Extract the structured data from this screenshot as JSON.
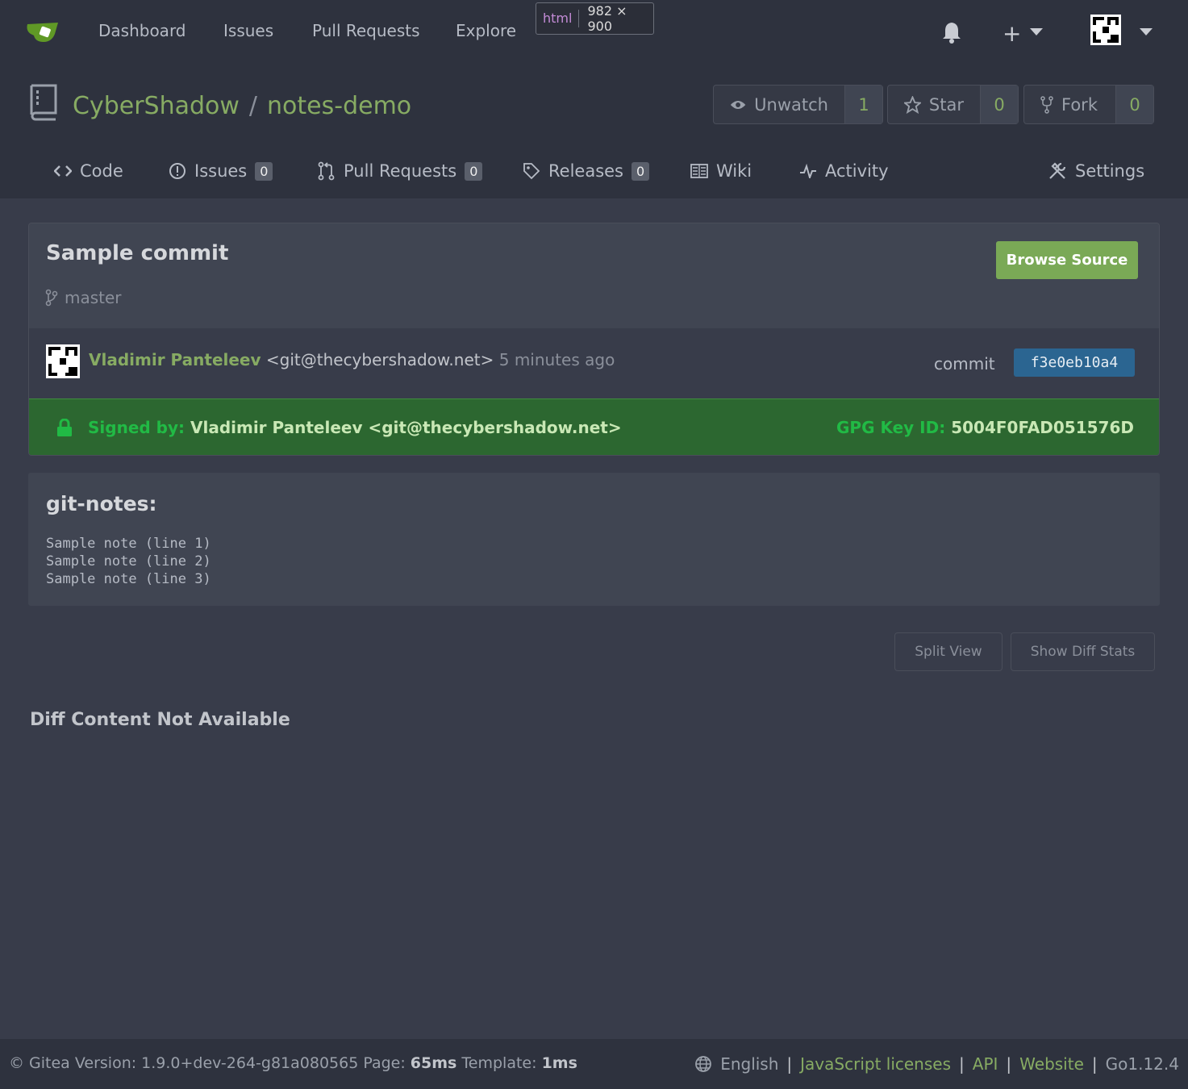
{
  "navbar": {
    "items": [
      "Dashboard",
      "Issues",
      "Pull Requests",
      "Explore"
    ],
    "devtip_tag": "html",
    "devtip_dim": "982 × 900",
    "plus": "+"
  },
  "repo": {
    "owner": "CyberShadow",
    "separator": "/",
    "name": "notes-demo",
    "watch": {
      "label": "Unwatch",
      "count": "1"
    },
    "star": {
      "label": "Star",
      "count": "0"
    },
    "fork": {
      "label": "Fork",
      "count": "0"
    }
  },
  "tabs": [
    {
      "label": "Code",
      "icon": "code-icon"
    },
    {
      "label": "Issues",
      "badge": "0",
      "icon": "issue-icon"
    },
    {
      "label": "Pull Requests",
      "badge": "0",
      "icon": "pr-icon"
    },
    {
      "label": "Releases",
      "badge": "0",
      "icon": "tag-icon"
    },
    {
      "label": "Wiki",
      "icon": "book-icon"
    },
    {
      "label": "Activity",
      "icon": "pulse-icon"
    },
    {
      "label": "Settings",
      "icon": "tools-icon"
    }
  ],
  "commit": {
    "title": "Sample commit",
    "branch": "master",
    "browse_source": "Browse Source",
    "author_name": "Vladimir Panteleev",
    "author_email": "<git@thecybershadow.net>",
    "time_ago": "5 minutes ago",
    "commit_label": "commit",
    "sha": "f3e0eb10a4",
    "signed_label": "Signed by:",
    "signed_by": "Vladimir Panteleev <git@thecybershadow.net>",
    "gpg_label": "GPG Key ID:",
    "gpg_id": "5004F0FAD051576D"
  },
  "notes": {
    "title": "git-notes:",
    "body": "Sample note (line 1)\nSample note (line 2)\nSample note (line 3)"
  },
  "diff": {
    "split_view": "Split View",
    "show_diff_stats": "Show Diff Stats",
    "not_available": "Diff Content Not Available"
  },
  "footer": {
    "copyright": "© Gitea Version: 1.9.0+dev-264-g81a080565 Page:",
    "page_time": "65ms",
    "template_label": "Template:",
    "template_time": "1ms",
    "language": "English",
    "links": [
      "JavaScript licenses",
      "API",
      "Website"
    ],
    "go_version": "Go1.12.4"
  },
  "colors": {
    "accent": "#87ab63",
    "signed_bg": "#2c6730",
    "sha_bg": "#2b6591"
  }
}
